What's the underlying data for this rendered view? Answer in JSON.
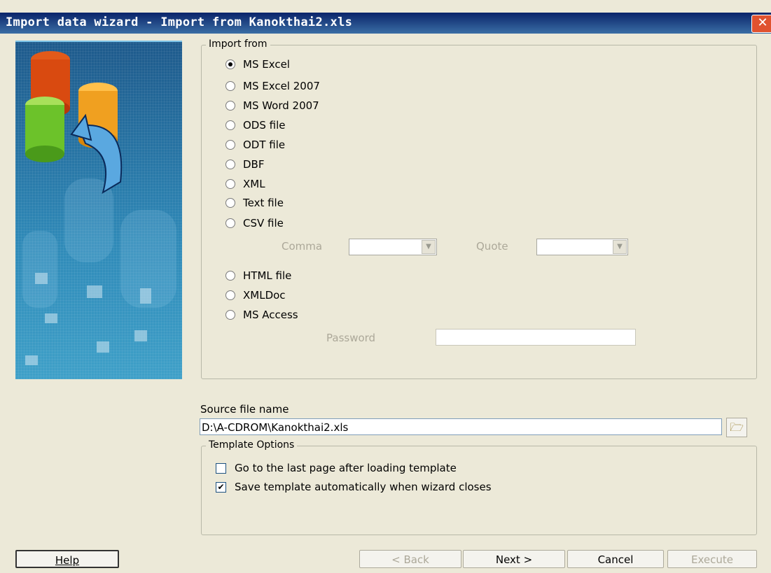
{
  "window": {
    "title": "Import data wizard - Import from Kanokthai2.xls",
    "close_glyph": "✕"
  },
  "import_from": {
    "title": "Import from",
    "options": [
      {
        "label": "MS Excel",
        "selected": true
      },
      {
        "label": "MS Excel 2007",
        "selected": false
      },
      {
        "label": "MS Word 2007",
        "selected": false
      },
      {
        "label": "ODS file",
        "selected": false
      },
      {
        "label": "ODT file",
        "selected": false
      },
      {
        "label": "DBF",
        "selected": false
      },
      {
        "label": "XML",
        "selected": false
      },
      {
        "label": "Text file",
        "selected": false
      },
      {
        "label": "CSV file",
        "selected": false
      },
      {
        "label": "HTML file",
        "selected": false
      },
      {
        "label": "XMLDoc",
        "selected": false
      },
      {
        "label": "MS Access",
        "selected": false
      }
    ],
    "csv": {
      "comma_label": "Comma",
      "quote_label": "Quote"
    },
    "access": {
      "password_label": "Password",
      "password_value": ""
    }
  },
  "source": {
    "label": "Source file name",
    "value": "D:\\A-CDROM\\Kanokthai2.xls"
  },
  "template_options": {
    "title": "Template Options",
    "go_last_page": {
      "label": "Go to the last page after loading template",
      "checked": false
    },
    "save_auto": {
      "label": "Save template automatically when wizard closes",
      "checked": true,
      "mark": "✔"
    }
  },
  "buttons": {
    "help": "Help",
    "back": "< Back",
    "next": "Next >",
    "cancel": "Cancel",
    "execute": "Execute"
  },
  "icons": {
    "browse": "folder-open-icon",
    "banner": "database-import-illustration"
  },
  "colors": {
    "title_start": "#0a246a",
    "title_end": "#3a6ea5",
    "dialog_bg": "#ece9d8",
    "close": "#e0522f"
  }
}
